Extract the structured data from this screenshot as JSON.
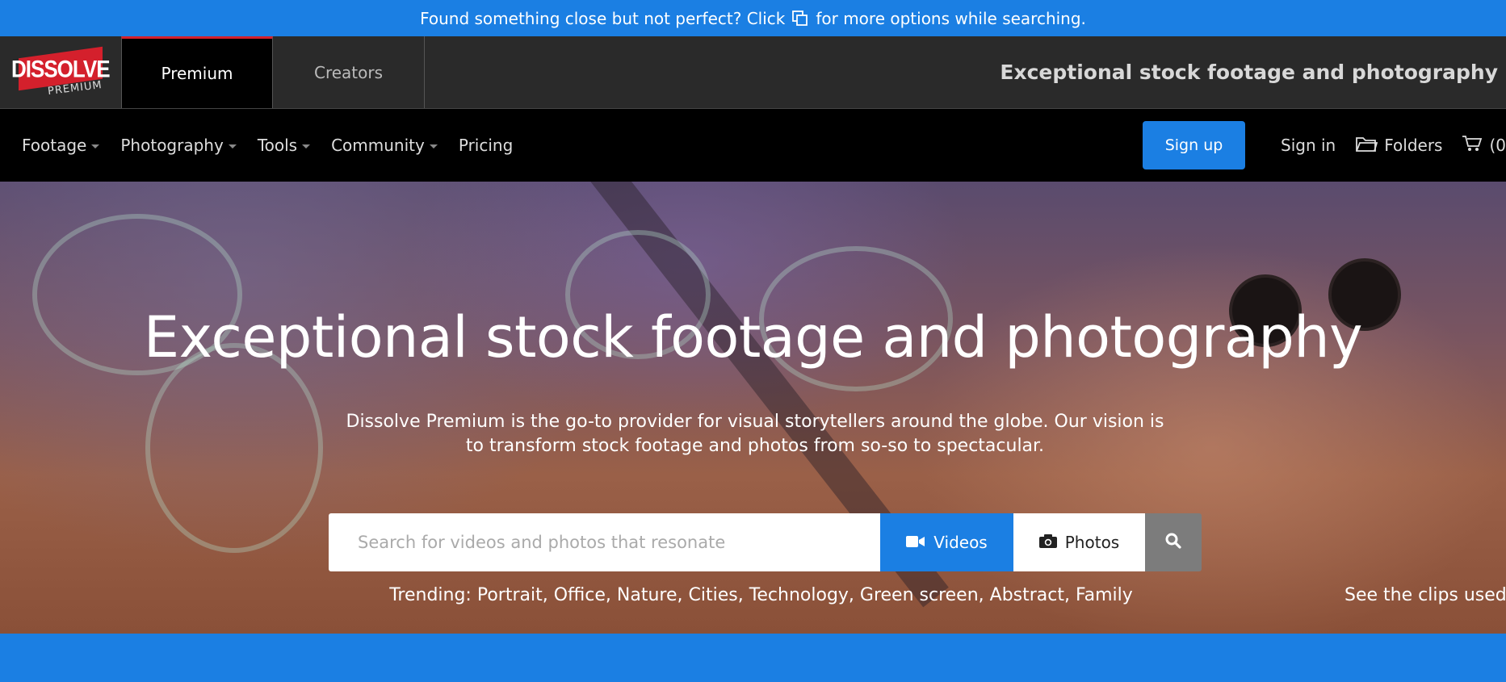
{
  "notice": {
    "before": "Found something close but not perfect? Click",
    "after": "for more options while searching."
  },
  "logo": {
    "main": "DISSOLVE",
    "sub": "PREMIUM"
  },
  "tabs": [
    {
      "label": "Premium"
    },
    {
      "label": "Creators"
    }
  ],
  "tagline": "Exceptional stock footage and photography",
  "nav": {
    "items": [
      {
        "label": "Footage"
      },
      {
        "label": "Photography"
      },
      {
        "label": "Tools"
      },
      {
        "label": "Community"
      },
      {
        "label": "Pricing"
      }
    ],
    "signup": "Sign up",
    "signin": "Sign in",
    "folders": "Folders",
    "cart": "(0"
  },
  "hero": {
    "title": "Exceptional stock footage and photography",
    "subtitle": "Dissolve Premium is the go-to provider for visual storytellers around the globe. Our vision is to transform stock footage and photos from so-so to spectacular.",
    "search_placeholder": "Search for videos and photos that resonate",
    "videos": "Videos",
    "photos": "Photos",
    "trending": "Trending: Portrait, Office, Nature, Cities, Technology, Green screen, Abstract, Family",
    "see_clips": "See the clips used"
  },
  "colors": {
    "accent": "#1b7fe3",
    "brand_red": "#d4202c",
    "topbar": "#2a2a2a",
    "nav": "#000000"
  }
}
